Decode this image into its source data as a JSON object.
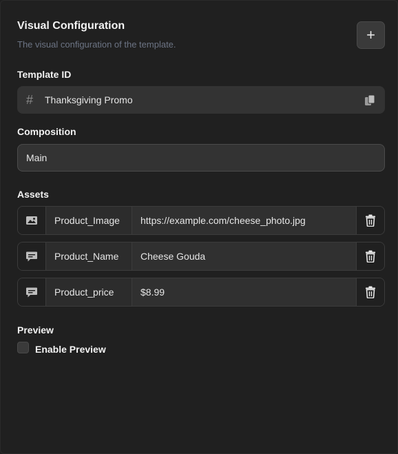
{
  "header": {
    "title": "Visual Configuration",
    "subtitle": "The visual configuration of the template.",
    "add_label": "+"
  },
  "template_id": {
    "label": "Template ID",
    "icon": "hash-icon",
    "prefix": "#",
    "value": "Thanksgiving Promo"
  },
  "composition": {
    "label": "Composition",
    "value": "Main"
  },
  "assets": {
    "label": "Assets",
    "items": [
      {
        "type_icon": "image-icon",
        "name": "Product_Image",
        "value": "https://example.com/cheese_photo.jpg"
      },
      {
        "type_icon": "text-message-icon",
        "name": "Product_Name",
        "value": "Cheese Gouda"
      },
      {
        "type_icon": "text-message-icon",
        "name": "Product_price",
        "value": "$8.99"
      }
    ]
  },
  "preview": {
    "label": "Preview",
    "checkbox_label": "Enable Preview",
    "enabled": false
  },
  "colors": {
    "background": "#202020",
    "field": "#333333",
    "subtitle": "#6c7484"
  }
}
